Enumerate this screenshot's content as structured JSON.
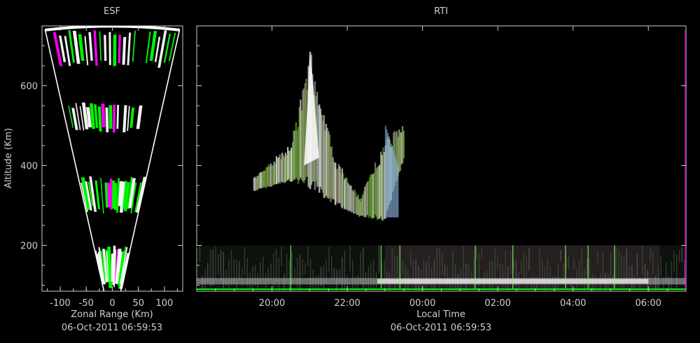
{
  "charts": {
    "esf": {
      "title": "ESF",
      "xlabel": "Zonal Range (Km)",
      "ylabel": "Altitude (Km)",
      "timestamp": "06-Oct-2011 06:59:53",
      "x_ticks": [
        "-100",
        "-50",
        "0",
        "50",
        "100"
      ],
      "y_ticks": [
        "200",
        "400",
        "600"
      ]
    },
    "rti": {
      "title": "RTI",
      "xlabel": "Local Time",
      "timestamp": "06-Oct-2011 06:59:53",
      "x_ticks": [
        "20:00",
        "22:00",
        "00:00",
        "02:00",
        "04:00",
        "06:00"
      ]
    }
  },
  "chart_data": [
    {
      "type": "heatmap",
      "title": "ESF",
      "xlabel": "Zonal Range (Km)",
      "ylabel": "Altitude (Km)",
      "xlim": [
        -135,
        135
      ],
      "ylim": [
        85,
        750
      ],
      "x_ticks": [
        -100,
        -50,
        0,
        50,
        100
      ],
      "y_ticks": [
        200,
        400,
        600
      ],
      "colors": {
        "white": "#ffffff",
        "green": "#00ff00",
        "magenta": "#ff00ff"
      },
      "echo_bands_altitude_km": [
        [
          645,
          740
        ],
        [
          480,
          560
        ],
        [
          280,
          375
        ],
        [
          90,
          200
        ]
      ]
    },
    {
      "type": "heatmap",
      "title": "RTI",
      "xlabel": "Local Time",
      "ylabel": "Altitude (Km)",
      "xlim_hours": [
        18.0,
        31.0
      ],
      "ylim": [
        85,
        750
      ],
      "x_ticks": [
        "20:00",
        "22:00",
        "00:00",
        "02:00",
        "04:00",
        "06:00"
      ],
      "plume_track": [
        {
          "time": "19:30",
          "alt_min": 335,
          "alt_max": 370
        },
        {
          "time": "20:30",
          "alt_min": 360,
          "alt_max": 460
        },
        {
          "time": "21:00",
          "alt_min": 340,
          "alt_max": 690
        },
        {
          "time": "21:40",
          "alt_min": 300,
          "alt_max": 420
        },
        {
          "time": "22:20",
          "alt_min": 270,
          "alt_max": 320
        },
        {
          "time": "23:00",
          "alt_min": 260,
          "alt_max": 480
        },
        {
          "time": "23:30",
          "alt_min": 420,
          "alt_max": 510
        }
      ],
      "low_layer_altitude_km": [
        90,
        200
      ]
    }
  ]
}
